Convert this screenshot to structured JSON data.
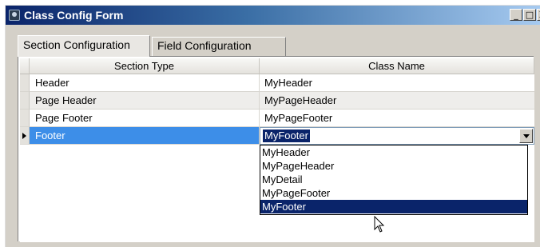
{
  "window": {
    "title": "Class Config Form"
  },
  "titlebar_buttons": {
    "minimize": "_",
    "maximize": "□",
    "close": "X"
  },
  "tabs": [
    {
      "label": "Section Configuration",
      "active": true
    },
    {
      "label": "Field Configuration",
      "active": false
    }
  ],
  "grid": {
    "columns": [
      "Section Type",
      "Class Name"
    ],
    "rows": [
      {
        "section_type": "Header",
        "class_name": "MyHeader"
      },
      {
        "section_type": "Page Header",
        "class_name": "MyPageHeader"
      },
      {
        "section_type": "Page Footer",
        "class_name": "MyPageFooter"
      },
      {
        "section_type": "Footer",
        "class_name": "MyFooter",
        "selected": true
      }
    ]
  },
  "combo": {
    "value": "MyFooter",
    "options": [
      "MyHeader",
      "MyPageHeader",
      "MyDetail",
      "MyPageFooter",
      "MyFooter"
    ],
    "highlighted": "MyFooter"
  },
  "colors": {
    "selection_blue": "#3d8ee8",
    "highlight_navy": "#0a246a",
    "titlebar_start": "#0a246a",
    "window_face": "#d4d0c8"
  },
  "icons": {
    "app": "app-icon",
    "row_indicator": "current-row-arrow-icon",
    "combo_arrow": "chevron-down-icon",
    "cursor": "mouse-pointer-icon"
  }
}
